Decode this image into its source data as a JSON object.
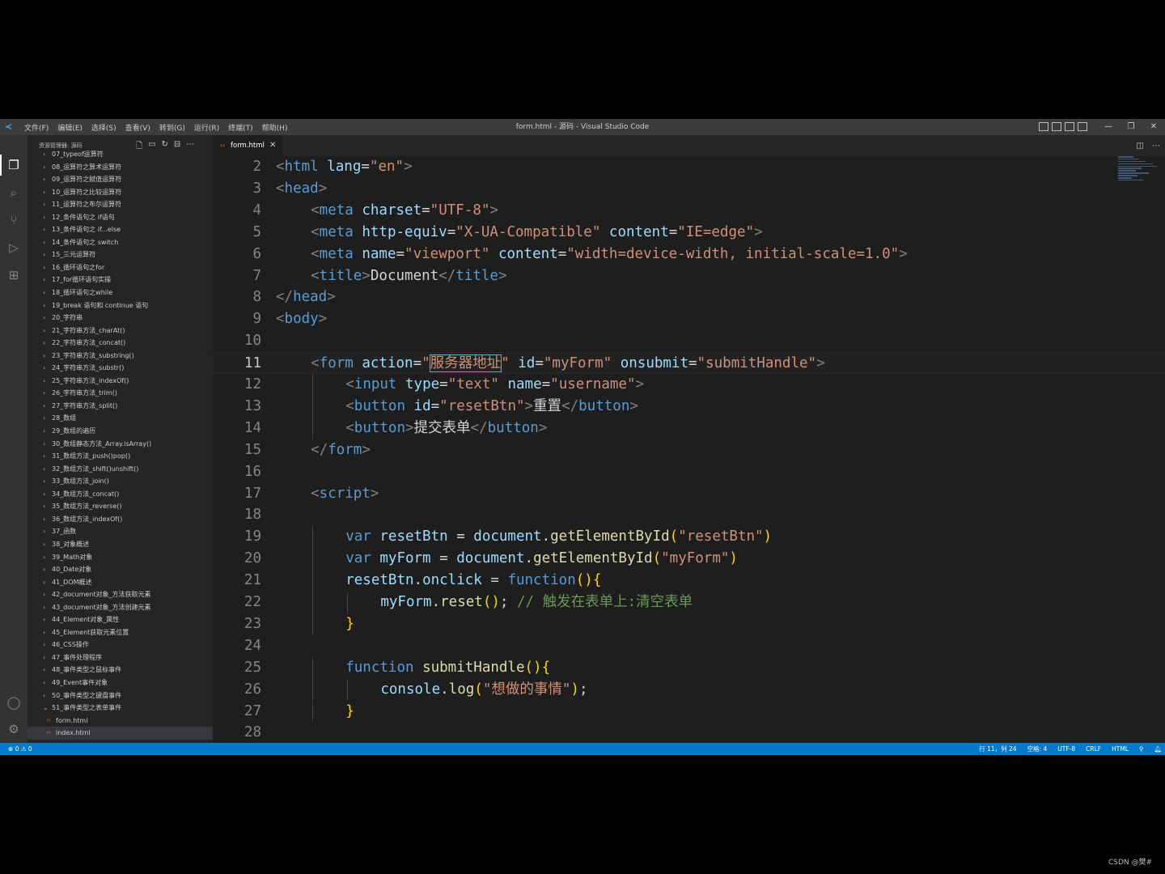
{
  "window": {
    "title": "form.html - 源码 - Visual Studio Code",
    "menu": [
      "文件(F)",
      "编辑(E)",
      "选择(S)",
      "查看(V)",
      "转到(G)",
      "运行(R)",
      "终端(T)",
      "帮助(H)"
    ]
  },
  "sidebar": {
    "title": "资源管理器: 源码",
    "items": [
      "07_typeof运算符",
      "08_运算符之算术运算符",
      "09_运算符之赋值运算符",
      "10_运算符之比较运算符",
      "11_运算符之布尔运算符",
      "12_条件语句之 if语句",
      "13_条件语句之 if...else",
      "14_条件语句之 switch",
      "15_三元运算符",
      "16_循环语句之for",
      "17_for循环语句实操",
      "18_循环语句之while",
      "19_break 语句和 continue 语句",
      "20_字符串",
      "21_字符串方法_charAt()",
      "22_字符串方法_concat()",
      "23_字符串方法_substring()",
      "24_字符串方法_substr()",
      "25_字符串方法_indexOf()",
      "26_字符串方法_trim()",
      "27_字符串方法_split()",
      "28_数组",
      "29_数组的遍历",
      "30_数组静态方法_Array.isArray()",
      "31_数组方法_push()pop()",
      "32_数组方法_shift()unshift()",
      "33_数组方法_join()",
      "34_数组方法_concat()",
      "35_数组方法_reverse()",
      "36_数组方法_indexOf()",
      "37_函数",
      "38_对象概述",
      "39_Math对象",
      "40_Date对象",
      "41_DOM概述",
      "42_document对象_方法获取元素",
      "43_document对象_方法创建元素",
      "44_Element对象_属性",
      "45_Element获取元素位置",
      "46_CSS操作",
      "47_事件处理程序",
      "48_事件类型之鼠标事件",
      "49_Event事件对象",
      "50_事件类型之键盘事件",
      "51_事件类型之表单事件"
    ],
    "files": [
      "form.html",
      "index.html"
    ]
  },
  "editor": {
    "tab": "form.html",
    "current_line": 11
  },
  "code_lines": [
    {
      "n": "2",
      "i": 0,
      "t": [
        [
          "<",
          "br"
        ],
        [
          "html",
          "tag"
        ],
        [
          " lang",
          "attr"
        ],
        [
          "=",
          "txt"
        ],
        [
          "\"en\"",
          "str"
        ],
        [
          ">",
          "br"
        ]
      ]
    },
    {
      "n": "3",
      "i": 0,
      "t": [
        [
          "<",
          "br"
        ],
        [
          "head",
          "tag"
        ],
        [
          ">",
          "br"
        ]
      ]
    },
    {
      "n": "4",
      "i": 1,
      "t": [
        [
          "<",
          "br"
        ],
        [
          "meta",
          "tag"
        ],
        [
          " charset",
          "attr"
        ],
        [
          "=",
          "txt"
        ],
        [
          "\"UTF-8\"",
          "str"
        ],
        [
          ">",
          "br"
        ]
      ]
    },
    {
      "n": "5",
      "i": 1,
      "t": [
        [
          "<",
          "br"
        ],
        [
          "meta",
          "tag"
        ],
        [
          " http-equiv",
          "attr"
        ],
        [
          "=",
          "txt"
        ],
        [
          "\"X-UA-Compatible\"",
          "str"
        ],
        [
          " content",
          "attr"
        ],
        [
          "=",
          "txt"
        ],
        [
          "\"IE=edge\"",
          "str"
        ],
        [
          ">",
          "br"
        ]
      ]
    },
    {
      "n": "6",
      "i": 1,
      "t": [
        [
          "<",
          "br"
        ],
        [
          "meta",
          "tag"
        ],
        [
          " name",
          "attr"
        ],
        [
          "=",
          "txt"
        ],
        [
          "\"viewport\"",
          "str"
        ],
        [
          " content",
          "attr"
        ],
        [
          "=",
          "txt"
        ],
        [
          "\"width=device-width, initial-scale=1.0\"",
          "str"
        ],
        [
          ">",
          "br"
        ]
      ]
    },
    {
      "n": "7",
      "i": 1,
      "t": [
        [
          "<",
          "br"
        ],
        [
          "title",
          "tag"
        ],
        [
          ">",
          "br"
        ],
        [
          "Document",
          "txt"
        ],
        [
          "</",
          "br"
        ],
        [
          "title",
          "tag"
        ],
        [
          ">",
          "br"
        ]
      ]
    },
    {
      "n": "8",
      "i": 0,
      "t": [
        [
          "</",
          "br"
        ],
        [
          "head",
          "tag"
        ],
        [
          ">",
          "br"
        ]
      ]
    },
    {
      "n": "9",
      "i": 0,
      "t": [
        [
          "<",
          "br"
        ],
        [
          "body",
          "tag"
        ],
        [
          ">",
          "br"
        ]
      ]
    },
    {
      "n": "10",
      "i": 0,
      "t": []
    },
    {
      "n": "11",
      "i": 1,
      "t": [
        [
          "<",
          "br"
        ],
        [
          "form",
          "tag"
        ],
        [
          " action",
          "attr"
        ],
        [
          "=",
          "txt"
        ],
        [
          "\"",
          "str"
        ],
        [
          "服务器地址",
          "str box"
        ],
        [
          "\"",
          "str"
        ],
        [
          " id",
          "attr"
        ],
        [
          "=",
          "txt"
        ],
        [
          "\"myForm\"",
          "str"
        ],
        [
          " onsubmit",
          "attr"
        ],
        [
          "=",
          "txt"
        ],
        [
          "\"submitHandle\"",
          "str"
        ],
        [
          ">",
          "br"
        ]
      ]
    },
    {
      "n": "12",
      "i": 2,
      "t": [
        [
          "<",
          "br"
        ],
        [
          "input",
          "tag"
        ],
        [
          " type",
          "attr"
        ],
        [
          "=",
          "txt"
        ],
        [
          "\"text\"",
          "str"
        ],
        [
          " name",
          "attr"
        ],
        [
          "=",
          "txt"
        ],
        [
          "\"username\"",
          "str"
        ],
        [
          ">",
          "br"
        ]
      ]
    },
    {
      "n": "13",
      "i": 2,
      "t": [
        [
          "<",
          "br"
        ],
        [
          "button",
          "tag"
        ],
        [
          " id",
          "attr"
        ],
        [
          "=",
          "txt"
        ],
        [
          "\"resetBtn\"",
          "str"
        ],
        [
          ">",
          "br"
        ],
        [
          "重置",
          "txt"
        ],
        [
          "</",
          "br"
        ],
        [
          "button",
          "tag"
        ],
        [
          ">",
          "br"
        ]
      ]
    },
    {
      "n": "14",
      "i": 2,
      "t": [
        [
          "<",
          "br"
        ],
        [
          "button",
          "tag"
        ],
        [
          ">",
          "br"
        ],
        [
          "提交表单",
          "txt"
        ],
        [
          "</",
          "br"
        ],
        [
          "button",
          "tag"
        ],
        [
          ">",
          "br"
        ]
      ]
    },
    {
      "n": "15",
      "i": 1,
      "t": [
        [
          "</",
          "br"
        ],
        [
          "form",
          "tag"
        ],
        [
          ">",
          "br"
        ]
      ]
    },
    {
      "n": "16",
      "i": 0,
      "t": []
    },
    {
      "n": "17",
      "i": 1,
      "t": [
        [
          "<",
          "br"
        ],
        [
          "script",
          "tag"
        ],
        [
          ">",
          "br"
        ]
      ]
    },
    {
      "n": "18",
      "i": 0,
      "t": []
    },
    {
      "n": "19",
      "i": 2,
      "t": [
        [
          "var",
          "kw"
        ],
        [
          " resetBtn",
          "var"
        ],
        [
          " = ",
          "txt"
        ],
        [
          "document",
          "var"
        ],
        [
          ".",
          "txt"
        ],
        [
          "getElementById",
          "fn"
        ],
        [
          "(",
          "p1"
        ],
        [
          "\"resetBtn\"",
          "str"
        ],
        [
          ")",
          "p1"
        ]
      ]
    },
    {
      "n": "20",
      "i": 2,
      "t": [
        [
          "var",
          "kw"
        ],
        [
          " myForm",
          "var"
        ],
        [
          " = ",
          "txt"
        ],
        [
          "document",
          "var"
        ],
        [
          ".",
          "txt"
        ],
        [
          "getElementById",
          "fn"
        ],
        [
          "(",
          "p1"
        ],
        [
          "\"myForm\"",
          "str"
        ],
        [
          ")",
          "p1"
        ]
      ]
    },
    {
      "n": "21",
      "i": 2,
      "t": [
        [
          "resetBtn",
          "var"
        ],
        [
          ".",
          "txt"
        ],
        [
          "onclick",
          "var"
        ],
        [
          " = ",
          "txt"
        ],
        [
          "function",
          "kw"
        ],
        [
          "()",
          "p1"
        ],
        [
          "{",
          "p1"
        ]
      ]
    },
    {
      "n": "22",
      "i": 3,
      "t": [
        [
          "myForm",
          "var"
        ],
        [
          ".",
          "txt"
        ],
        [
          "reset",
          "fn"
        ],
        [
          "()",
          "p1"
        ],
        [
          "; ",
          "txt"
        ],
        [
          "// 触发在表单上:清空表单",
          "com"
        ]
      ]
    },
    {
      "n": "23",
      "i": 2,
      "t": [
        [
          "}",
          "p1"
        ]
      ]
    },
    {
      "n": "24",
      "i": 0,
      "t": []
    },
    {
      "n": "25",
      "i": 2,
      "t": [
        [
          "function",
          "kw"
        ],
        [
          " submitHandle",
          "fn"
        ],
        [
          "()",
          "p1"
        ],
        [
          "{",
          "p1"
        ]
      ]
    },
    {
      "n": "26",
      "i": 3,
      "t": [
        [
          "console",
          "var"
        ],
        [
          ".",
          "txt"
        ],
        [
          "log",
          "fn"
        ],
        [
          "(",
          "p1"
        ],
        [
          "\"想做的事情\"",
          "str"
        ],
        [
          ")",
          "p1"
        ],
        [
          ";",
          "txt"
        ]
      ]
    },
    {
      "n": "27",
      "i": 2,
      "t": [
        [
          "}",
          "p1"
        ]
      ]
    },
    {
      "n": "28",
      "i": 0,
      "t": []
    }
  ],
  "status": {
    "problems": "⊗ 0 ⚠ 0",
    "position": "行 11，列 24",
    "spaces": "空格: 4",
    "encoding": "UTF-8",
    "eol": "CRLF",
    "language": "HTML"
  },
  "watermark": "CSDN @樊#",
  "colors": {
    "accent": "#007acc",
    "background": "#1e1e1e",
    "sidebar": "#252526"
  }
}
